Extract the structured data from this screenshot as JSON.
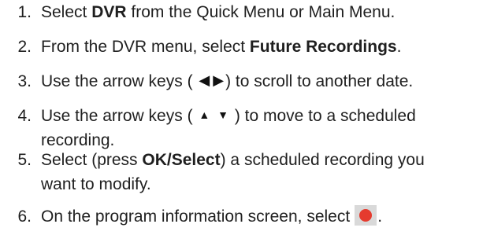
{
  "steps": [
    {
      "number": "1.",
      "pre": "Select ",
      "bold": "DVR",
      "post": " from the Quick Menu or Main Menu."
    },
    {
      "number": "2.",
      "pre": "From the DVR menu, select ",
      "bold": "Future Recordings",
      "post": "."
    },
    {
      "number": "3.",
      "pre": "Use the arrow keys (",
      "icon_left": "◀",
      "icon_right": "▶",
      "post": ") to scroll to another date."
    },
    {
      "number": "4.",
      "pre": "Use the arrow keys (",
      "icon_up": "▲",
      "icon_down": "▼",
      "post": ") to move to a scheduled",
      "line2": "recording."
    },
    {
      "number": "5.",
      "pre": "Select (press ",
      "bold": "OK/Select",
      "post": ") a scheduled recording you",
      "line2": "want to modify."
    },
    {
      "number": "6.",
      "pre": "On the program information screen, select",
      "icon": "record-button-icon",
      "post": "."
    }
  ],
  "colors": {
    "text": "#1f1f1f",
    "record_dot": "#e53b2e",
    "record_bg": "#d9d9d9"
  }
}
